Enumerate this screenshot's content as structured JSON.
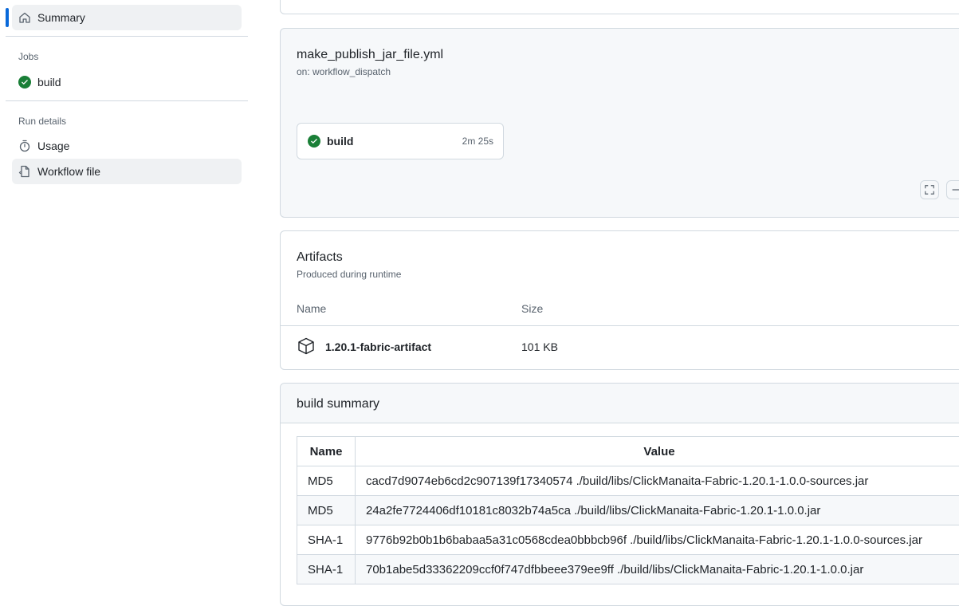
{
  "sidebar": {
    "summary_label": "Summary",
    "jobs_heading": "Jobs",
    "job_label": "build",
    "run_details_heading": "Run details",
    "usage_label": "Usage",
    "workflow_file_label": "Workflow file"
  },
  "workflow": {
    "file_name": "make_publish_jar_file.yml",
    "trigger": "on: workflow_dispatch",
    "job_name": "build",
    "job_duration": "2m 25s"
  },
  "artifacts": {
    "title": "Artifacts",
    "subtitle": "Produced during runtime",
    "col_name": "Name",
    "col_size": "Size",
    "item_name": "1.20.1-fabric-artifact",
    "item_size": "101 KB"
  },
  "build_summary": {
    "title": "build summary",
    "header_name": "Name",
    "header_value": "Value",
    "rows": [
      {
        "name": "MD5",
        "value": "cacd7d9074eb6cd2c907139f17340574 ./build/libs/ClickManaita-Fabric-1.20.1-1.0.0-sources.jar"
      },
      {
        "name": "MD5",
        "value": "24a2fe7724406df10181c8032b74a5ca ./build/libs/ClickManaita-Fabric-1.20.1-1.0.0.jar"
      },
      {
        "name": "SHA-1",
        "value": "9776b92b0b1b6babaa5a31c0568cdea0bbbcb96f ./build/libs/ClickManaita-Fabric-1.20.1-1.0.0-sources.jar"
      },
      {
        "name": "SHA-1",
        "value": "70b1abe5d33362209ccf0f747dfbbeee379ee9ff ./build/libs/ClickManaita-Fabric-1.20.1-1.0.0.jar"
      }
    ]
  },
  "colors": {
    "accent": "#0969da",
    "success": "#1a7f37",
    "border": "#d1d9e0",
    "muted_text": "#59636e"
  }
}
